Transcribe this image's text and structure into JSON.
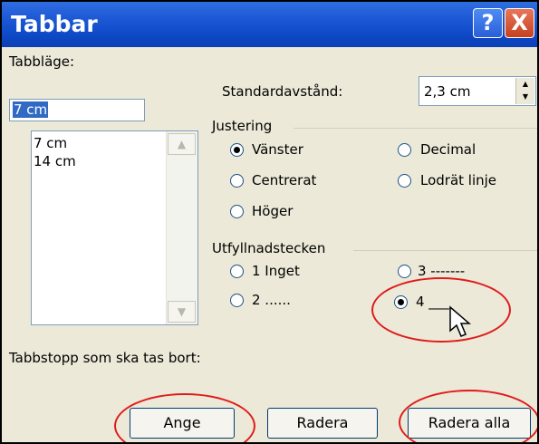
{
  "dialog": {
    "title": "Tabbar",
    "help_glyph": "?",
    "close_glyph": "X"
  },
  "tab_position": {
    "label": "Tabbläge:",
    "value": "7 cm",
    "list": [
      "7 cm",
      "14 cm"
    ]
  },
  "default_spacing": {
    "label": "Standardavstånd:",
    "value": "2,3 cm"
  },
  "alignment": {
    "legend": "Justering",
    "options": [
      {
        "label": "Vänster",
        "selected": true
      },
      {
        "label": "Centrerat",
        "selected": false
      },
      {
        "label": "Höger",
        "selected": false
      },
      {
        "label": "Decimal",
        "selected": false
      },
      {
        "label": "Lodrät linje",
        "selected": false
      }
    ]
  },
  "leader": {
    "legend": "Utfyllnadstecken",
    "options": [
      {
        "label": "1 Inget",
        "selected": false
      },
      {
        "label": "2 ......",
        "selected": false
      },
      {
        "label": "3 -------",
        "selected": false
      },
      {
        "label": "4 ___",
        "selected": true
      }
    ]
  },
  "clear_label": "Tabbstopp som ska tas bort:",
  "buttons": {
    "set": "Ange",
    "clear": "Radera",
    "clear_all": "Radera alla"
  },
  "colors": {
    "titlebar": "#0a3fb6",
    "highlight": "#316ac5",
    "annotation_oval": "#e01b1b"
  }
}
